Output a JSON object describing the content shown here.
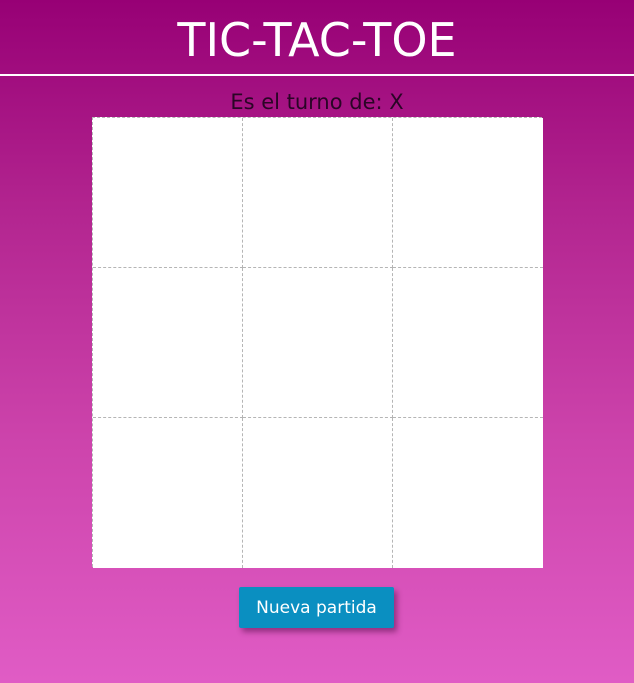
{
  "header": {
    "title": "TIC-TAC-TOE"
  },
  "status": {
    "prefix": "Es el turno de:",
    "current_player": "X"
  },
  "board": {
    "cells": [
      [
        "",
        "",
        ""
      ],
      [
        "",
        "",
        ""
      ],
      [
        "",
        "",
        ""
      ]
    ]
  },
  "controls": {
    "new_game_label": "Nueva partida"
  },
  "colors": {
    "background_top": "#970075",
    "background_bottom": "#e05cc5",
    "board": "#ffffff",
    "button": "#0a8fc1"
  }
}
